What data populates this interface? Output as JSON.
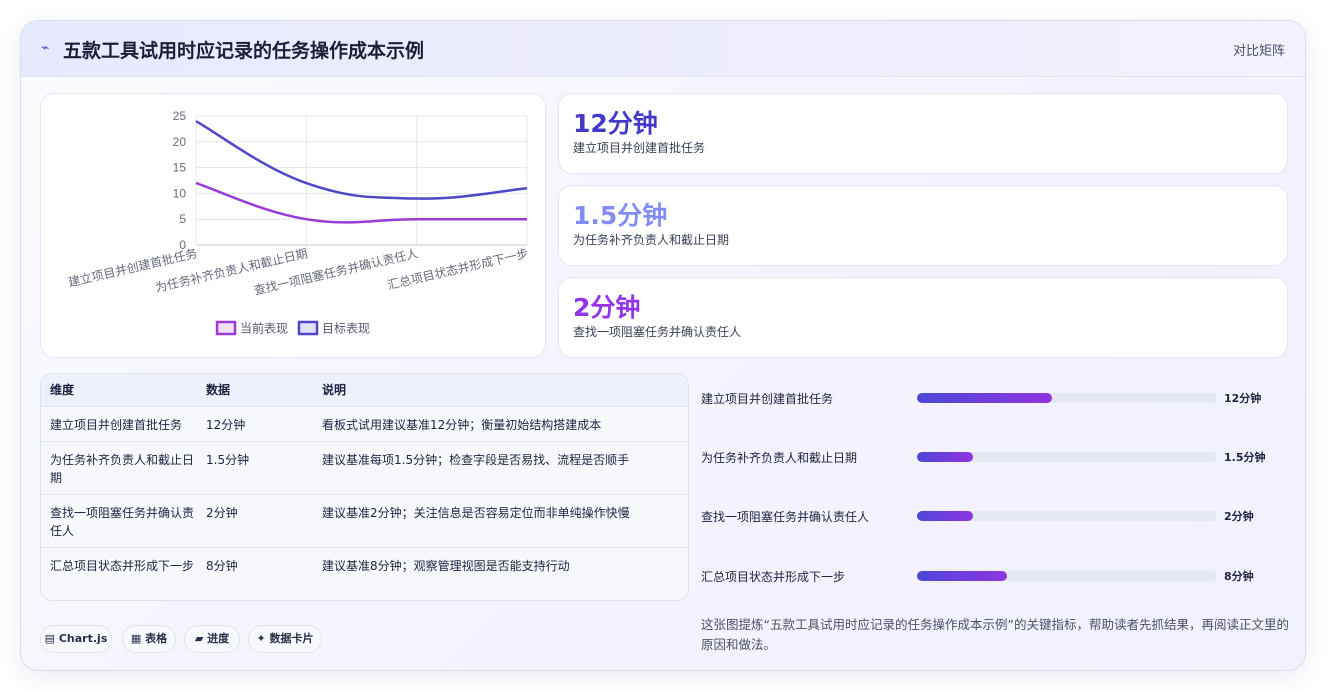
{
  "header": {
    "icon": "pulse-icon",
    "title": "五款工具试用时应记录的任务操作成本示例",
    "right_label": "对比矩阵"
  },
  "chart_data": {
    "type": "line",
    "categories": [
      "建立项目并创建首批任务",
      "为任务补齐负责人和截止日期",
      "查找一项阻塞任务并确认责任人",
      "汇总项目状态并形成下一步"
    ],
    "series": [
      {
        "name": "当前表现",
        "values": [
          12,
          5,
          5,
          5
        ],
        "color": "#9b3bd6"
      },
      {
        "name": "目标表现",
        "values": [
          24,
          12,
          9,
          11
        ],
        "color": "#4f46c8"
      }
    ],
    "y_ticks": [
      0,
      5,
      10,
      15,
      20,
      25
    ],
    "ylim": [
      0,
      25
    ],
    "grid": true,
    "legend_position": "bottom"
  },
  "kpis": [
    {
      "value": "12分钟",
      "label": "建立项目并创建首批任务",
      "color": "#4338ca"
    },
    {
      "value": "1.5分钟",
      "label": "为任务补齐负责人和截止日期",
      "color": "#818cf8"
    },
    {
      "value": "2分钟",
      "label": "查找一项阻塞任务并确认责任人",
      "color": "#9333ea"
    }
  ],
  "table": {
    "headers": [
      "维度",
      "数据",
      "说明"
    ],
    "rows": [
      [
        "建立项目并创建首批任务",
        "12分钟",
        "看板式试用建议基准12分钟；衡量初始结构搭建成本"
      ],
      [
        "为任务补齐负责人和截止日期",
        "1.5分钟",
        "建议基准每项1.5分钟；检查字段是否易找、流程是否顺手"
      ],
      [
        "查找一项阻塞任务并确认责任人",
        "2分钟",
        "建议基准2分钟；关注信息是否容易定位而非单纯操作快慢"
      ],
      [
        "汇总项目状态并形成下一步",
        "8分钟",
        "建议基准8分钟；观察管理视图是否能支持行动"
      ]
    ]
  },
  "progress": [
    {
      "label": "建立项目并创建首批任务",
      "value": "12分钟",
      "fraction": 0.45
    },
    {
      "label": "为任务补齐负责人和截止日期",
      "value": "1.5分钟",
      "fraction": 0.187
    },
    {
      "label": "查找一项阻塞任务并确认责任人",
      "value": "2分钟",
      "fraction": 0.187
    },
    {
      "label": "汇总项目状态并形成下一步",
      "value": "8分钟",
      "fraction": 0.3
    }
  ],
  "note": "这张图提炼“五款工具试用时应记录的任务操作成本示例”的关键指标，帮助读者先抓结果，再阅读正文里的原因和做法。",
  "tags": [
    {
      "icon": "chart-icon",
      "glyph": "▤",
      "label": "Chart.js"
    },
    {
      "icon": "table-icon",
      "glyph": "▦",
      "label": "表格"
    },
    {
      "icon": "folder-icon",
      "glyph": "▰",
      "label": "进度"
    },
    {
      "icon": "sparkle-icon",
      "glyph": "✦",
      "label": "数据卡片"
    }
  ]
}
